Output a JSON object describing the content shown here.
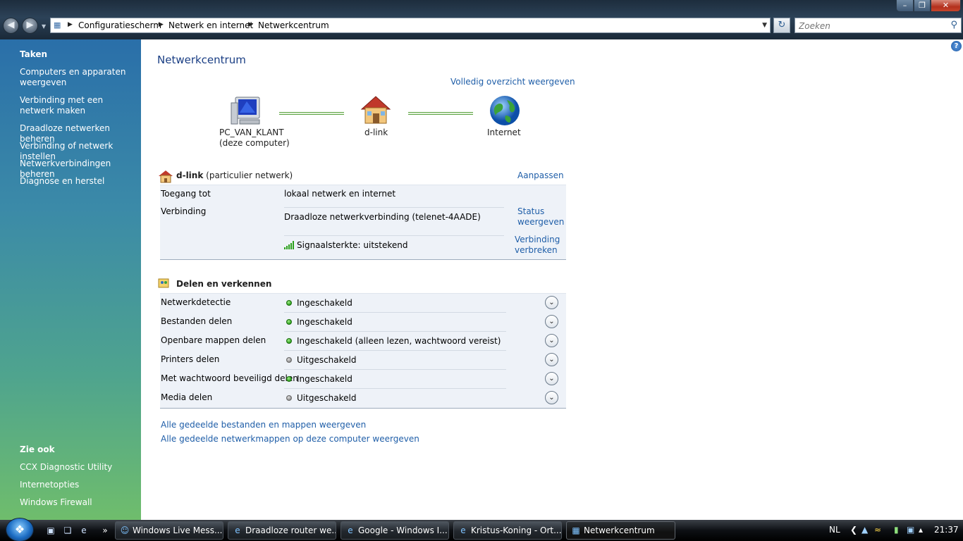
{
  "window": {
    "minimize_icon": "minimize-icon",
    "maximize_icon": "restore-icon",
    "close_icon": "close-icon"
  },
  "address": {
    "breadcrumbs": [
      "Configuratiescherm",
      "Netwerk en internet",
      "Netwerkcentrum"
    ]
  },
  "search": {
    "placeholder": "Zoeken"
  },
  "sidebar": {
    "tasks_heading": "Taken",
    "tasks": [
      "Computers en apparaten weergeven",
      "Verbinding met een netwerk maken",
      "Draadloze netwerken beheren",
      "Verbinding of netwerk instellen",
      "Netwerkverbindingen beheren",
      "Diagnose en herstel"
    ],
    "see_also_heading": "Zie ook",
    "see_also": [
      "CCX Diagnostic Utility",
      "Internetopties",
      "Windows Firewall"
    ]
  },
  "main": {
    "title": "Netwerkcentrum",
    "full_map_link": "Volledig overzicht weergeven",
    "map": {
      "computer_name": "PC_VAN_KLANT",
      "computer_sub": "(deze computer)",
      "network_name": "d-link",
      "internet": "Internet"
    },
    "network": {
      "name": "d-link",
      "type": "(particulier netwerk)",
      "customize": "Aanpassen",
      "access_label": "Toegang tot",
      "access_value": "lokaal netwerk en internet",
      "connection_label": "Verbinding",
      "connection_value": "Draadloze netwerkverbinding (telenet-4AADE)",
      "status_link_1": "Status",
      "status_link_2": "weergeven",
      "signal": "Signaalsterkte: uitstekend",
      "disconnect_link_1": "Verbinding",
      "disconnect_link_2": "verbreken"
    },
    "sharing": {
      "heading": "Delen en verkennen",
      "rows": [
        {
          "label": "Netwerkdetectie",
          "value": "Ingeschakeld",
          "on": true
        },
        {
          "label": "Bestanden delen",
          "value": "Ingeschakeld",
          "on": true
        },
        {
          "label": "Openbare mappen delen",
          "value": "Ingeschakeld (alleen lezen, wachtwoord vereist)",
          "on": true
        },
        {
          "label": "Printers delen",
          "value": "Uitgeschakeld",
          "on": false
        },
        {
          "label": "Met wachtwoord beveiligd delen",
          "value": "Ingeschakeld",
          "on": true
        },
        {
          "label": "Media delen",
          "value": "Uitgeschakeld",
          "on": false
        }
      ]
    },
    "bottom_links": [
      "Alle gedeelde bestanden en mappen weergeven",
      "Alle gedeelde netwerkmappen op deze computer weergeven"
    ]
  },
  "taskbar": {
    "tasks": [
      {
        "label": "Windows Live Mess...",
        "icon": "messenger-icon"
      },
      {
        "label": "Draadloze router we...",
        "icon": "ie-icon"
      },
      {
        "label": "Google - Windows I...",
        "icon": "ie-icon"
      },
      {
        "label": "Kristus-Koning - Ort...",
        "icon": "ie-icon"
      },
      {
        "label": "Netwerkcentrum",
        "icon": "network-center-icon"
      }
    ],
    "language": "NL",
    "clock": "21:37"
  }
}
